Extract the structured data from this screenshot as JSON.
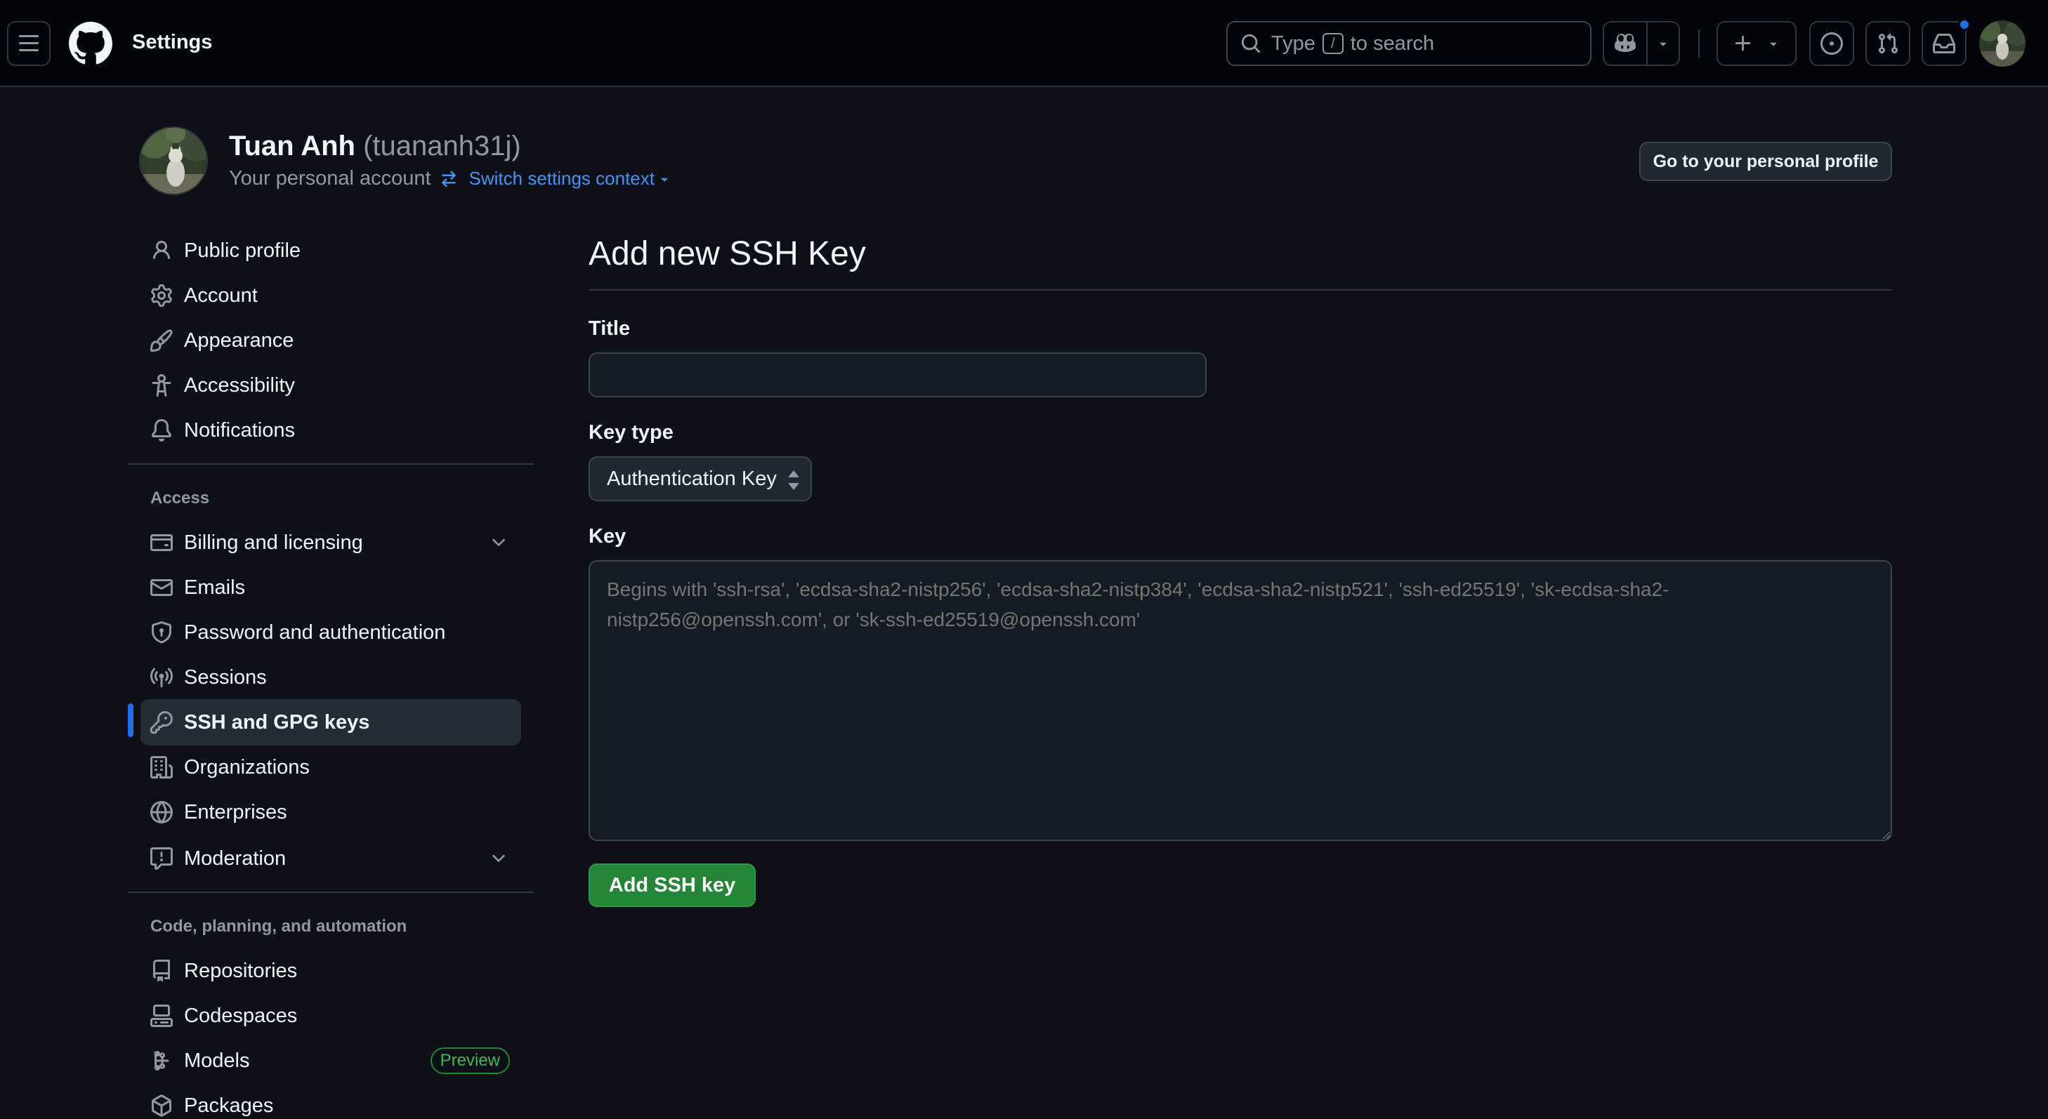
{
  "header": {
    "title": "Settings",
    "search": {
      "prefix": "Type",
      "key": "/",
      "suffix": "to search"
    },
    "icons": [
      "menu-icon",
      "github-logo",
      "search-icon",
      "copilot-icon",
      "chevron-down-icon",
      "plus-icon",
      "issues-icon",
      "pull-request-icon",
      "inbox-icon"
    ],
    "notification_color": "#1f6feb"
  },
  "profile": {
    "name": "Tuan Anh",
    "login": "(tuananh31j)",
    "subtitle": "Your personal account",
    "switch_context": "Switch settings context",
    "go_profile_button": "Go to your personal profile"
  },
  "sidebar": {
    "group1": [
      {
        "label": "Public profile",
        "icon": "person-icon"
      },
      {
        "label": "Account",
        "icon": "gear-icon"
      },
      {
        "label": "Appearance",
        "icon": "paintbrush-icon"
      },
      {
        "label": "Accessibility",
        "icon": "accessibility-icon"
      },
      {
        "label": "Notifications",
        "icon": "bell-icon"
      }
    ],
    "access_heading": "Access",
    "group2": [
      {
        "label": "Billing and licensing",
        "icon": "credit-card-icon",
        "expandable": true
      },
      {
        "label": "Emails",
        "icon": "mail-icon"
      },
      {
        "label": "Password and authentication",
        "icon": "shield-icon"
      },
      {
        "label": "Sessions",
        "icon": "broadcast-icon"
      },
      {
        "label": "SSH and GPG keys",
        "icon": "key-icon",
        "selected": true
      },
      {
        "label": "Organizations",
        "icon": "organization-icon"
      },
      {
        "label": "Enterprises",
        "icon": "globe-icon"
      },
      {
        "label": "Moderation",
        "icon": "report-icon",
        "expandable": true
      }
    ],
    "code_heading": "Code, planning, and automation",
    "group3": [
      {
        "label": "Repositories",
        "icon": "repo-icon"
      },
      {
        "label": "Codespaces",
        "icon": "codespaces-icon"
      },
      {
        "label": "Models",
        "icon": "models-icon",
        "badge": "Preview"
      },
      {
        "label": "Packages",
        "icon": "package-icon"
      }
    ],
    "accent_color": "#1f6feb"
  },
  "form": {
    "heading": "Add new SSH Key",
    "title_label": "Title",
    "title_value": "",
    "key_type_label": "Key type",
    "key_type_value": "Authentication Key",
    "key_label": "Key",
    "key_placeholder": "Begins with 'ssh-rsa', 'ecdsa-sha2-nistp256', 'ecdsa-sha2-nistp384', 'ecdsa-sha2-nistp521', 'ssh-ed25519', 'sk-ecdsa-sha2-nistp256@openssh.com', or 'sk-ssh-ed25519@openssh.com'",
    "submit_label": "Add SSH key",
    "submit_color": "#238636"
  }
}
